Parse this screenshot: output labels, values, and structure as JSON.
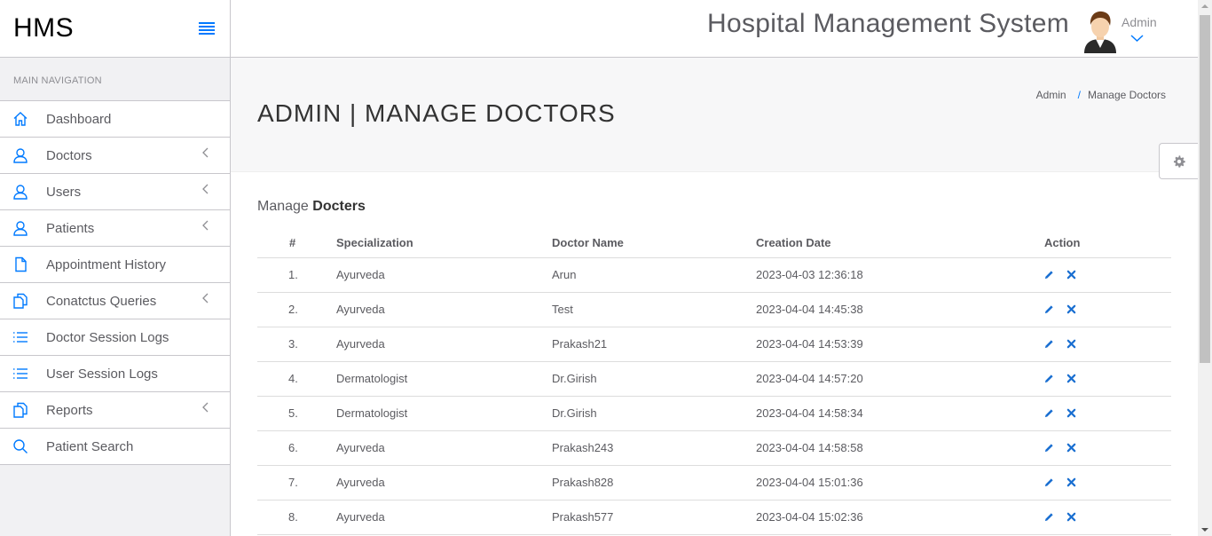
{
  "brand": {
    "name": "HMS"
  },
  "sidebar": {
    "heading": "MAIN NAVIGATION",
    "items": [
      {
        "label": "Dashboard",
        "icon": "home-icon",
        "submenu": false
      },
      {
        "label": "Doctors",
        "icon": "user-icon",
        "submenu": true
      },
      {
        "label": "Users",
        "icon": "user-icon",
        "submenu": true
      },
      {
        "label": "Patients",
        "icon": "user-icon",
        "submenu": true
      },
      {
        "label": "Appointment History",
        "icon": "file-icon",
        "submenu": false
      },
      {
        "label": "Conatctus Queries",
        "icon": "files-icon",
        "submenu": true
      },
      {
        "label": "Doctor Session Logs",
        "icon": "list-icon",
        "submenu": false
      },
      {
        "label": "User Session Logs",
        "icon": "list-icon",
        "submenu": false
      },
      {
        "label": "Reports",
        "icon": "files-icon",
        "submenu": true
      },
      {
        "label": "Patient Search",
        "icon": "search-icon",
        "submenu": false
      }
    ]
  },
  "header": {
    "title": "Hospital Management System",
    "user": "Admin"
  },
  "page": {
    "title": "ADMIN | MANAGE DOCTORS",
    "breadcrumb": [
      "Admin",
      "Manage Doctors"
    ]
  },
  "section": {
    "title_prefix": "Manage",
    "title_bold": "Docters"
  },
  "table": {
    "headers": [
      "#",
      "Specialization",
      "Doctor Name",
      "Creation Date",
      "Action"
    ],
    "rows": [
      {
        "num": "1.",
        "spec": "Ayurveda",
        "name": "Arun",
        "date": "2023-04-03 12:36:18"
      },
      {
        "num": "2.",
        "spec": "Ayurveda",
        "name": "Test",
        "date": "2023-04-04 14:45:38"
      },
      {
        "num": "3.",
        "spec": "Ayurveda",
        "name": "Prakash21",
        "date": "2023-04-04 14:53:39"
      },
      {
        "num": "4.",
        "spec": "Dermatologist",
        "name": "Dr.Girish",
        "date": "2023-04-04 14:57:20"
      },
      {
        "num": "5.",
        "spec": "Dermatologist",
        "name": "Dr.Girish",
        "date": "2023-04-04 14:58:34"
      },
      {
        "num": "6.",
        "spec": "Ayurveda",
        "name": "Prakash243",
        "date": "2023-04-04 14:58:58"
      },
      {
        "num": "7.",
        "spec": "Ayurveda",
        "name": "Prakash828",
        "date": "2023-04-04 15:01:36"
      },
      {
        "num": "8.",
        "spec": "Ayurveda",
        "name": "Prakash577",
        "date": "2023-04-04 15:02:36"
      }
    ]
  },
  "colors": {
    "accent": "#007aff",
    "sidebar_bg": "#f1f1f3",
    "header_bg": "#f7f7f8"
  }
}
